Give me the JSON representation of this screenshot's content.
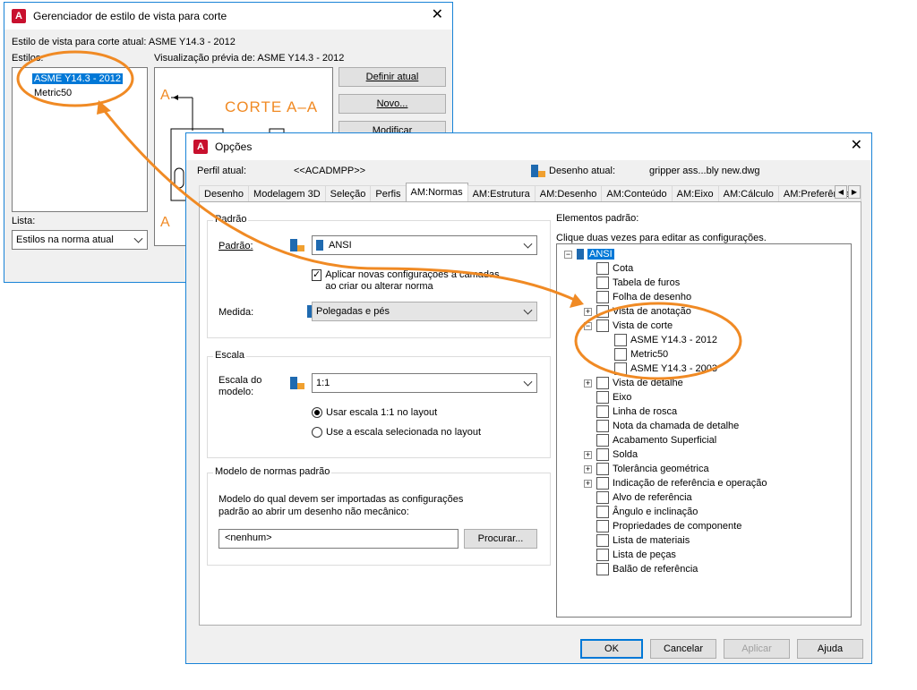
{
  "back_window": {
    "title": "Gerenciador de estilo de vista para corte",
    "current_style_label": "Estilo de vista para corte atual: ASME Y14.3 - 2012",
    "styles_label": "Estilos:",
    "styles": [
      "ASME Y14.3 - 2012",
      "Metric50"
    ],
    "preview_label": "Visualização prévia de: ASME Y14.3 - 2012",
    "preview_letter_top": "A",
    "preview_letter_bottom": "A",
    "preview_caption": "CORTE A–A",
    "buttons": [
      "Definir atual",
      "Novo...",
      "Modificar"
    ],
    "list_label": "Lista:",
    "list_value": "Estilos na norma atual"
  },
  "options": {
    "title": "Opções",
    "profile_label": "Perfil atual:",
    "profile_value": "<<ACADMPP>>",
    "drawing_label": "Desenho atual:",
    "drawing_value": "gripper ass...bly new.dwg",
    "tabs": [
      "Desenho",
      "Modelagem 3D",
      "Seleção",
      "Perfis",
      "AM:Normas",
      "AM:Estrutura",
      "AM:Desenho",
      "AM:Conteúdo",
      "AM:Eixo",
      "AM:Cálculo",
      "AM:Preferências"
    ],
    "active_tab": "AM:Normas",
    "padrao_group": "Padrão",
    "padrao_label": "Padrão:",
    "padrao_value": "ANSI",
    "apply_checkbox": "Aplicar novas configurações a camadas ao criar ou alterar norma",
    "medida_label": "Medida:",
    "medida_value": "Polegadas e pés",
    "escala_group": "Escala",
    "escala_label": "Escala do modelo:",
    "escala_value": "1:1",
    "radio_1": "Usar escala 1:1 no layout",
    "radio_2": "Use a escala selecionada no layout",
    "modelo_group": "Modelo de normas padrão",
    "modelo_text": "Modelo do qual devem ser importadas as configurações padrão ao abrir um desenho não mecânico:",
    "modelo_value": "<nenhum>",
    "procurar": "Procurar...",
    "elements_label": "Elementos padrão:",
    "elements_hint": "Clique duas vezes para editar as configurações.",
    "tree_root": "ANSI",
    "tree": [
      "Cota",
      "Tabela de furos",
      "Folha de desenho",
      "Vista de anotação",
      "Vista de corte",
      "ASME Y14.3 - 2012",
      "Metric50",
      "ASME Y14.3 - 2003",
      "Vista de detalhe",
      "Eixo",
      "Linha de rosca",
      "Nota da chamada de detalhe",
      "Acabamento Superficial",
      "Solda",
      "Tolerância geométrica",
      "Indicação de referência e operação",
      "Alvo de referência",
      "Ângulo e inclinação",
      "Propriedades de componente",
      "Lista de materiais",
      "Lista de peças",
      "Balão de referência"
    ],
    "buttons": [
      "OK",
      "Cancelar",
      "Aplicar",
      "Ajuda"
    ]
  },
  "colors": {
    "accent": "#f08a24",
    "selection": "#0078d7",
    "title_border": "#1883d7"
  }
}
